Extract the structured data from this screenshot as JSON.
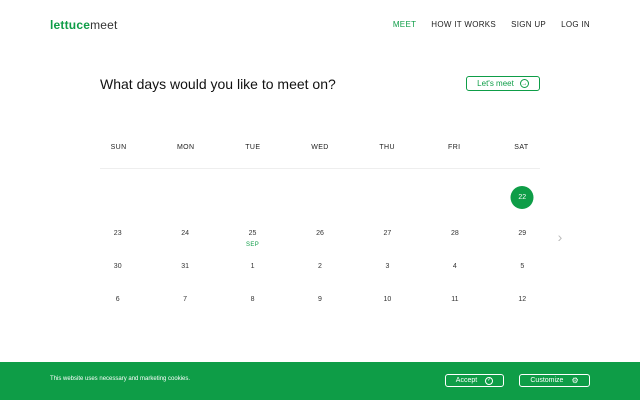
{
  "header": {
    "logo_brand": "lettuce",
    "logo_suffix": "meet",
    "nav": [
      {
        "label": "MEET",
        "active": true
      },
      {
        "label": "HOW IT WORKS",
        "active": false
      },
      {
        "label": "SIGN UP",
        "active": false
      },
      {
        "label": "LOG IN",
        "active": false
      }
    ]
  },
  "main": {
    "question": "What days would you like to meet on?",
    "cta_label": "Let's meet",
    "cta_icon": "arrow-right-circle-icon"
  },
  "calendar": {
    "weekdays": [
      "SUN",
      "MON",
      "TUE",
      "WED",
      "THU",
      "FRI",
      "SAT"
    ],
    "weeks": [
      [
        "",
        "",
        "",
        "",
        "",
        "",
        "22"
      ],
      [
        "23",
        "24",
        "25",
        "26",
        "27",
        "28",
        "29"
      ],
      [
        "30",
        "31",
        "1",
        "2",
        "3",
        "4",
        "5"
      ],
      [
        "6",
        "7",
        "8",
        "9",
        "10",
        "11",
        "12"
      ]
    ],
    "selected_day": "22",
    "month_marker": {
      "label": "SEP",
      "day": "1"
    },
    "accent_color": "#0e9d47",
    "next_icon": "chevron-right-icon"
  },
  "cookie_bar": {
    "message": "This website uses necessary and marketing cookies.",
    "accept_label": "Accept",
    "accept_icon": "check-circle-icon",
    "customize_label": "Customize",
    "customize_icon": "gear-icon",
    "background": "#0e9d47"
  }
}
